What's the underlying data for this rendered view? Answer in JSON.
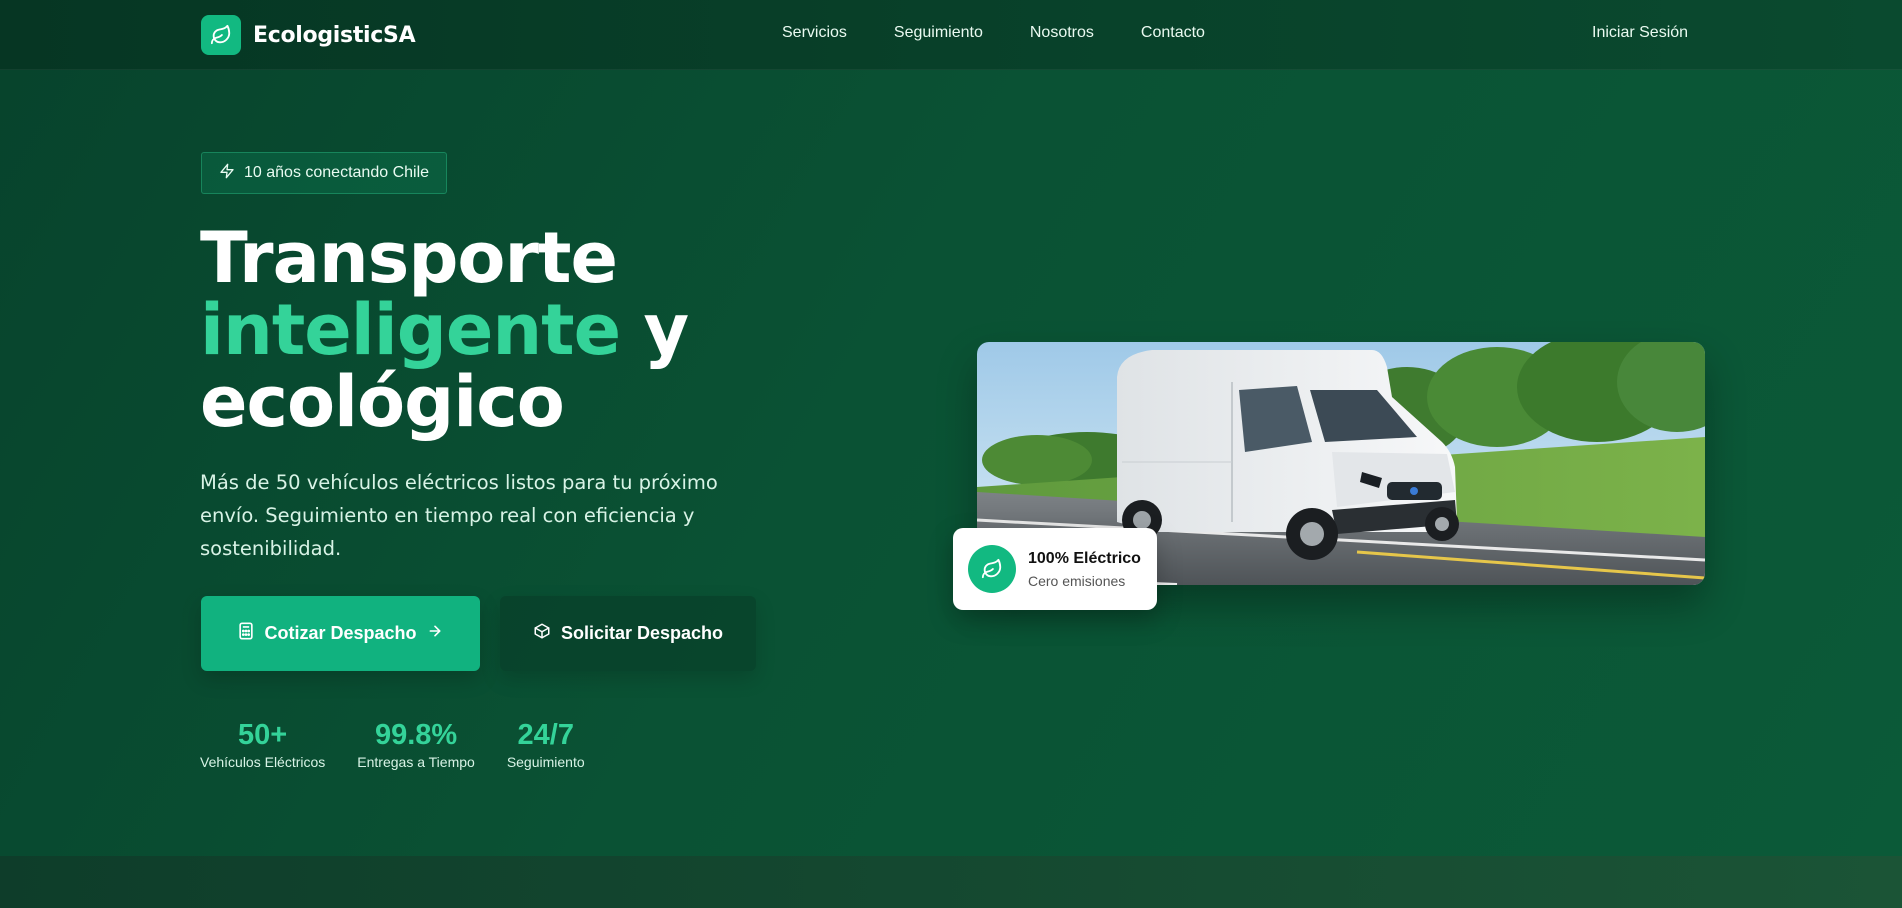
{
  "brand": {
    "name": "EcologisticSA",
    "icon": "leaf-icon",
    "accent": "#12b981"
  },
  "nav": {
    "links": [
      "Servicios",
      "Seguimiento",
      "Nosotros",
      "Contacto"
    ],
    "login": "Iniciar Sesión"
  },
  "hero": {
    "badge": {
      "icon": "bolt-icon",
      "text": "10 años conectando Chile"
    },
    "headline": {
      "line1": "Transporte",
      "accent": "inteligente",
      "after_accent": " y",
      "line3": "ecológico"
    },
    "subtitle": "Más de 50 vehículos eléctricos listos para tu próximo envío. Seguimiento en tiempo real con eficiencia y sostenibilidad.",
    "primary_button": {
      "icon": "calculator-icon",
      "label": "Cotizar Despacho",
      "trailing_icon": "arrow-right-icon"
    },
    "secondary_button": {
      "icon": "box-icon",
      "label": "Solicitar Despacho"
    },
    "stats": [
      {
        "value": "50+",
        "label": "Vehículos Eléctricos"
      },
      {
        "value": "99.8%",
        "label": "Entregas a Tiempo"
      },
      {
        "value": "24/7",
        "label": "Seguimiento"
      }
    ]
  },
  "feature_card": {
    "icon": "leaf-icon",
    "title": "100% Eléctrico",
    "subtitle": "Cero emisiones"
  },
  "colors": {
    "accent_text": "#34d399",
    "background": "#0a5234",
    "nav_background": "#063623"
  }
}
